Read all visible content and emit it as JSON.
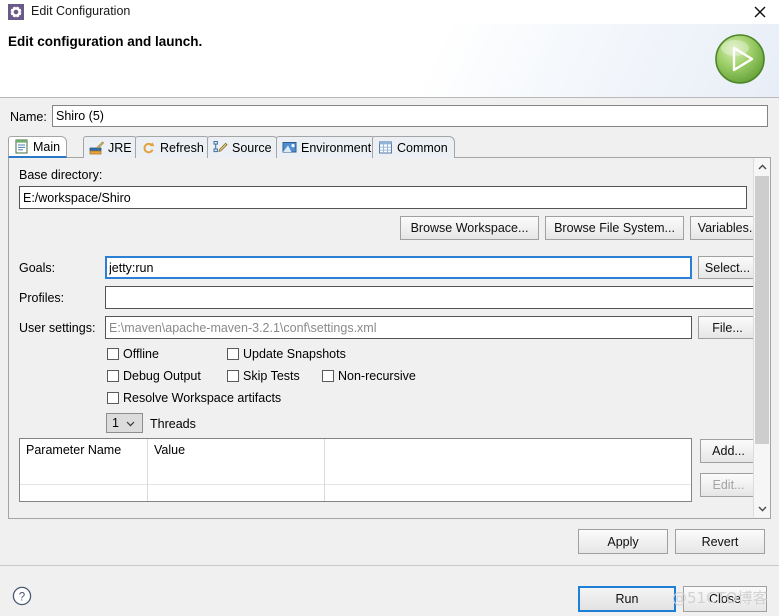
{
  "window": {
    "title": "Edit Configuration",
    "icon": "gear-icon",
    "close_icon": "close-icon"
  },
  "header": {
    "title": "Edit configuration and launch.",
    "run_icon": "green-play-icon"
  },
  "name": {
    "label": "Name:",
    "value": "Shiro (5)"
  },
  "tabs": [
    {
      "label": "Main",
      "icon": "document-icon",
      "active": true
    },
    {
      "label": "JRE",
      "icon": "books-icon",
      "active": false
    },
    {
      "label": "Refresh",
      "icon": "refresh-icon",
      "active": false
    },
    {
      "label": "Source",
      "icon": "pencil-icon",
      "active": false
    },
    {
      "label": "Environment",
      "icon": "monitor-icon",
      "active": false
    },
    {
      "label": "Common",
      "icon": "table-icon",
      "active": false
    }
  ],
  "main_tab": {
    "base_directory": {
      "label": "Base directory:",
      "value": "E:/workspace/Shiro"
    },
    "browse_buttons": [
      {
        "label": "Browse Workspace..."
      },
      {
        "label": "Browse File System..."
      },
      {
        "label": "Variables..."
      }
    ],
    "goals": {
      "label": "Goals:",
      "value": "jetty:run",
      "button": "Select..."
    },
    "profiles": {
      "label": "Profiles:",
      "value": ""
    },
    "user_settings": {
      "label": "User settings:",
      "value": "E:\\maven\\apache-maven-3.2.1\\conf\\settings.xml",
      "button": "File..."
    },
    "checkboxes": [
      {
        "label": "Offline",
        "checked": false
      },
      {
        "label": "Update Snapshots",
        "checked": false
      },
      {
        "label": "Debug Output",
        "checked": false
      },
      {
        "label": "Skip Tests",
        "checked": false
      },
      {
        "label": "Non-recursive",
        "checked": false
      },
      {
        "label": "Resolve Workspace artifacts",
        "checked": false
      }
    ],
    "threads": {
      "value": "1",
      "label": "Threads"
    },
    "parameter_table": {
      "columns": [
        "Parameter Name",
        "Value"
      ],
      "rows": []
    },
    "table_buttons": [
      {
        "label": "Add...",
        "enabled": true
      },
      {
        "label": "Edit...",
        "enabled": false
      }
    ]
  },
  "footer": {
    "apply": "Apply",
    "revert": "Revert",
    "run": "Run",
    "close": "Close",
    "help_icon": "help-icon",
    "watermark": "@51CTO博客"
  },
  "colors": {
    "accent_blue": "#2b78c8",
    "focus_blue": "#1e7fd6",
    "dialog_bg": "#f0f0f0",
    "green_run": "#79bd3f"
  }
}
